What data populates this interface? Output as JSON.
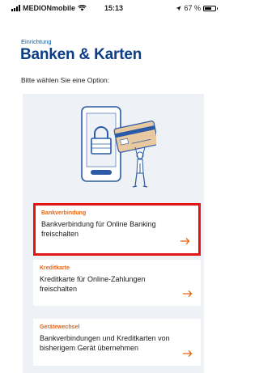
{
  "status_bar": {
    "carrier": "MEDIONmobile",
    "time": "15:13",
    "battery": "67 %",
    "battery_level": 0.67
  },
  "header": {
    "overline": "Einrichtung",
    "title": "Banken & Karten",
    "subtitle": "Bitte wählen Sie eine Option:"
  },
  "options": [
    {
      "category": "Bankverbindung",
      "text": "Bankverbindung für Online Banking freischalten",
      "selected": true
    },
    {
      "category": "Kreditkarte",
      "text": "Kreditkarte für Online-Zahlungen freischalten",
      "selected": false
    },
    {
      "category": "Gerätewechsel",
      "text": "Bankverbindungen und Kreditkarten von bisherigem Gerät übernehmen",
      "selected": false
    }
  ],
  "icons": [
    "signal-icon",
    "wifi-icon",
    "location-icon",
    "battery-icon",
    "lock-icon",
    "arrow-right-icon"
  ],
  "colors": {
    "title": "#0b3e86",
    "overline": "#0b5aa4",
    "category": "#e8650f",
    "panel": "#eef2f7",
    "highlight": "#e31414"
  }
}
